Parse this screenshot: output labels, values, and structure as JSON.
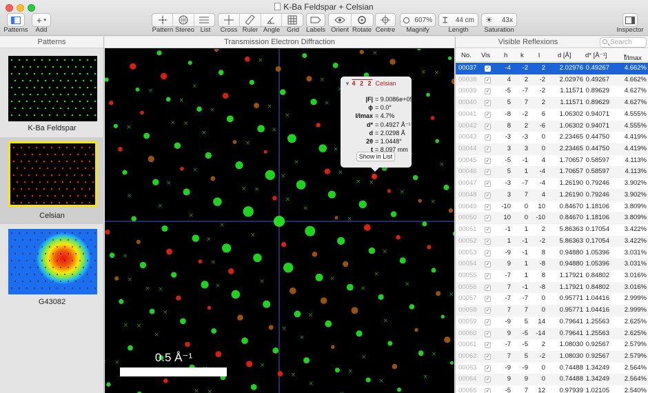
{
  "window": {
    "title": "K-Ba Feldspar + Celsian"
  },
  "toolbar": {
    "patterns": "Patterns",
    "add": "Add",
    "pattern": "Pattern",
    "stereo": "Stereo",
    "list": "List",
    "cross": "Cross",
    "ruler": "Ruler",
    "angle": "Angle",
    "grid": "Grid",
    "labels": "Labels",
    "orient": "Orient",
    "rotate": "Rotate",
    "centre": "Centre",
    "magnify": "Magnify",
    "magnify_value": "607%",
    "length": "Length",
    "length_value": "44 cm",
    "saturation": "Saturation",
    "saturation_value": "43x",
    "inspector": "Inspector"
  },
  "patterns_pane": {
    "header": "Patterns",
    "items": [
      {
        "label": "K-Ba Feldspar",
        "selected": false
      },
      {
        "label": "Celsian",
        "selected": true
      },
      {
        "label": "G43082",
        "selected": false
      }
    ]
  },
  "diffraction": {
    "header": "Transmission Electron Diffraction",
    "scale_label": "0.5 Å⁻¹",
    "colors": {
      "phase1": "#22dd22",
      "phase2": "#ee2211",
      "axis": "#4a57c8",
      "scalebar": "#ffffff"
    }
  },
  "popover": {
    "hkl": "4 2 2",
    "phase": "Celsian",
    "fields": [
      {
        "key": "|F|",
        "value": "= 9.0086e+05"
      },
      {
        "key": "ϕ",
        "value": "= 0.0°"
      },
      {
        "key": "I/Imax",
        "value": "= 4.7%"
      },
      {
        "key": "d*",
        "value": "= 0.4927 Å⁻¹"
      },
      {
        "key": "d",
        "value": "= 2.0298 Å"
      },
      {
        "key": "2θ",
        "value": "= 1.0448°"
      },
      {
        "key": "t",
        "value": "= 8.097 mm"
      }
    ],
    "button": "Show in List"
  },
  "reflexions": {
    "header": "Visible Reflexions",
    "search_placeholder": "Search",
    "columns": [
      "No.",
      "Vis",
      "h",
      "k",
      "l",
      "d [Å]",
      "d* [Å⁻¹]",
      "I/Imax"
    ],
    "rows": [
      [
        "00037",
        "-4",
        "-2",
        "2",
        "2.02976",
        "0.49267",
        "4.662%"
      ],
      [
        "00038",
        "4",
        "2",
        "-2",
        "2.02976",
        "0.49267",
        "4.662%"
      ],
      [
        "00039",
        "-5",
        "-7",
        "-2",
        "1.11571",
        "0.89629",
        "4.627%"
      ],
      [
        "00040",
        "5",
        "7",
        "2",
        "1.11571",
        "0.89629",
        "4.627%"
      ],
      [
        "00041",
        "-8",
        "-2",
        "6",
        "1.06302",
        "0.94071",
        "4.555%"
      ],
      [
        "00042",
        "8",
        "2",
        "-6",
        "1.06302",
        "0.94071",
        "4.555%"
      ],
      [
        "00043",
        "-3",
        "-3",
        "0",
        "2.23465",
        "0.44750",
        "4.419%"
      ],
      [
        "00044",
        "3",
        "3",
        "0",
        "2.23465",
        "0.44750",
        "4.419%"
      ],
      [
        "00045",
        "-5",
        "-1",
        "4",
        "1.70657",
        "0.58597",
        "4.113%"
      ],
      [
        "00046",
        "5",
        "1",
        "-4",
        "1.70657",
        "0.58597",
        "4.113%"
      ],
      [
        "00047",
        "-3",
        "-7",
        "-4",
        "1.26190",
        "0.79246",
        "3.902%"
      ],
      [
        "00048",
        "3",
        "7",
        "4",
        "1.26190",
        "0.79246",
        "3.902%"
      ],
      [
        "00049",
        "-10",
        "0",
        "10",
        "0.84670",
        "1.18106",
        "3.809%"
      ],
      [
        "00050",
        "10",
        "0",
        "-10",
        "0.84670",
        "1.18106",
        "3.809%"
      ],
      [
        "00051",
        "-1",
        "1",
        "2",
        "5.86363",
        "0.17054",
        "3.422%"
      ],
      [
        "00052",
        "1",
        "-1",
        "-2",
        "5.86363",
        "0.17054",
        "3.422%"
      ],
      [
        "00053",
        "-9",
        "-1",
        "8",
        "0.94880",
        "1.05396",
        "3.031%"
      ],
      [
        "00054",
        "9",
        "1",
        "-8",
        "0.94880",
        "1.05396",
        "3.031%"
      ],
      [
        "00055",
        "-7",
        "1",
        "8",
        "1.17921",
        "0.84802",
        "3.016%"
      ],
      [
        "00056",
        "7",
        "-1",
        "-8",
        "1.17921",
        "0.84802",
        "3.016%"
      ],
      [
        "00057",
        "-7",
        "-7",
        "0",
        "0.95771",
        "1.04416",
        "2.999%"
      ],
      [
        "00058",
        "7",
        "7",
        "0",
        "0.95771",
        "1.04416",
        "2.999%"
      ],
      [
        "00059",
        "-9",
        "5",
        "14",
        "0.79641",
        "1.25563",
        "2.625%"
      ],
      [
        "00060",
        "9",
        "-5",
        "-14",
        "0.79641",
        "1.25563",
        "2.625%"
      ],
      [
        "00061",
        "-7",
        "-5",
        "2",
        "1.08030",
        "0.92567",
        "2.579%"
      ],
      [
        "00062",
        "7",
        "5",
        "-2",
        "1.08030",
        "0.92567",
        "2.579%"
      ],
      [
        "00063",
        "-9",
        "-9",
        "0",
        "0.74488",
        "1.34249",
        "2.564%"
      ],
      [
        "00064",
        "9",
        "9",
        "0",
        "0.74488",
        "1.34249",
        "2.564%"
      ],
      [
        "00065",
        "-5",
        "7",
        "12",
        "0.97939",
        "1.02105",
        "2.540%"
      ]
    ]
  }
}
